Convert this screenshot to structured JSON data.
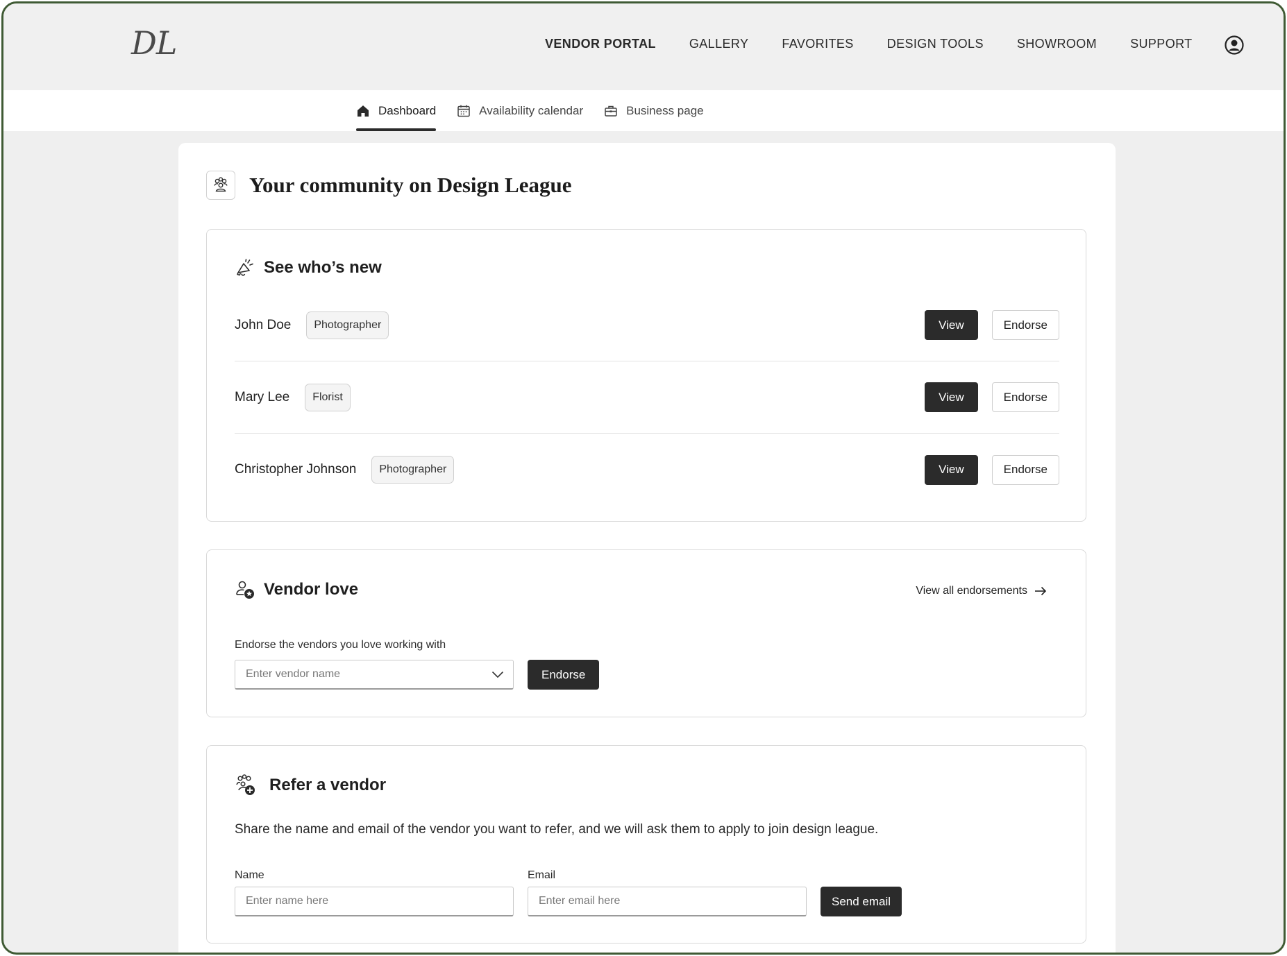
{
  "header": {
    "logo": "DL",
    "nav": [
      {
        "label": "VENDOR PORTAL",
        "active": true
      },
      {
        "label": "GALLERY",
        "active": false
      },
      {
        "label": "FAVORITES",
        "active": false
      },
      {
        "label": "DESIGN TOOLS",
        "active": false
      },
      {
        "label": "SHOWROOM",
        "active": false
      },
      {
        "label": "SUPPORT",
        "active": false
      }
    ],
    "user_icon": "user-circle-icon"
  },
  "subnav": {
    "tabs": [
      {
        "label": "Dashboard",
        "icon": "home-icon",
        "active": true
      },
      {
        "label": "Availability calendar",
        "icon": "calendar-icon",
        "active": false
      },
      {
        "label": "Business page",
        "icon": "briefcase-icon",
        "active": false
      }
    ]
  },
  "page": {
    "title": "Your community on Design League",
    "title_icon": "community-icon"
  },
  "whos_new": {
    "title": "See who’s new",
    "icon": "megaphone-icon",
    "vendors": [
      {
        "name": "John Doe",
        "role": "Photographer"
      },
      {
        "name": "Mary Lee",
        "role": "Florist"
      },
      {
        "name": "Christopher Johnson",
        "role": "Photographer"
      }
    ],
    "view_label": "View",
    "endorse_label": "Endorse"
  },
  "vendor_love": {
    "title": "Vendor love",
    "icon": "user-star-icon",
    "view_all_label": "View all endorsements",
    "field_label": "Endorse the vendors you love working with",
    "placeholder": "Enter vendor name",
    "button_label": "Endorse"
  },
  "refer": {
    "title": "Refer a vendor",
    "icon": "users-add-icon",
    "description": "Share the name and email of the vendor you want to refer, and we will ask them to apply to join design league.",
    "name_label": "Name",
    "name_placeholder": "Enter name here",
    "email_label": "Email",
    "email_placeholder": "Enter email here",
    "button_label": "Send email"
  },
  "colors": {
    "accent_dark": "#2b2b2b",
    "frame_border": "#3f5a34",
    "page_bg": "#efefef"
  }
}
